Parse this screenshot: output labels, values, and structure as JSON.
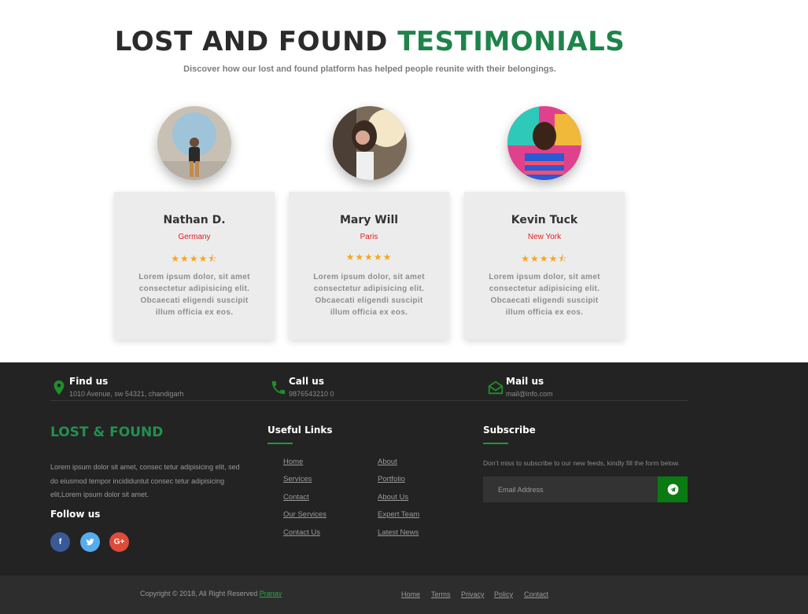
{
  "header": {
    "title_main": "LOST AND FOUND",
    "title_accent": "TESTIMONIALS",
    "subtitle": "Discover how our lost and found platform has helped people reunite with their belongings."
  },
  "testimonials": [
    {
      "name": "Nathan D.",
      "location": "Germany",
      "stars": "★★★★⯪",
      "rating": 4.5,
      "text": "Lorem ipsum dolor, sit amet consectetur adipisicing elit. Obcaecati eligendi suscipit illum officia ex eos."
    },
    {
      "name": "Mary Will",
      "location": "Paris",
      "stars": "★★★★★",
      "rating": 5,
      "text": "Lorem ipsum dolor, sit amet consectetur adipisicing elit. Obcaecati eligendi suscipit illum officia ex eos."
    },
    {
      "name": "Kevin Tuck",
      "location": "New York",
      "stars": "★★★★⯪",
      "rating": 4.5,
      "text": "Lorem ipsum dolor, sit amet consectetur adipisicing elit. Obcaecati eligendi suscipit illum officia ex eos."
    }
  ],
  "footer": {
    "contacts": [
      {
        "title": "Find us",
        "value": "1010 Avenue, sw 54321, chandigarh",
        "icon": "map-marker-icon"
      },
      {
        "title": "Call us",
        "value": "9876543210 0",
        "icon": "phone-icon"
      },
      {
        "title": "Mail us",
        "value": "mail@info.com",
        "icon": "envelope-icon"
      }
    ],
    "brand": "LOST & FOUND",
    "about": "Lorem ipsum dolor sit amet, consec tetur adipisicing elit, sed do eiusmod tempor incididuntut consec tetur adipisicing elit,Lorem ipsum dolor sit amet.",
    "follow_title": "Follow us",
    "social": [
      {
        "label": "f",
        "icon": "facebook-icon",
        "color": "#3b5998"
      },
      {
        "label": "t",
        "icon": "twitter-icon",
        "color": "#55acee"
      },
      {
        "label": "G+",
        "icon": "google-plus-icon",
        "color": "#dd4b39"
      }
    ],
    "links_title": "Useful Links",
    "links_left": [
      "Home",
      "Services",
      "Contact",
      "Our Services",
      "Contact Us"
    ],
    "links_right": [
      "About",
      "Portfolio",
      "About Us",
      "Expert Team",
      "Latest News"
    ],
    "subscribe_title": "Subscribe",
    "subscribe_text": "Don’t miss to subscribe to our new feeds, kindly fill the form below.",
    "email_placeholder": "Email Address",
    "accent_color": "#1a9a3a"
  },
  "bottom": {
    "copyright": "Copyright © 2018, All Right Reserved ",
    "author": "Pranav",
    "links": [
      "Home",
      "Terms",
      "Privacy",
      "Policy",
      "Contact"
    ]
  }
}
